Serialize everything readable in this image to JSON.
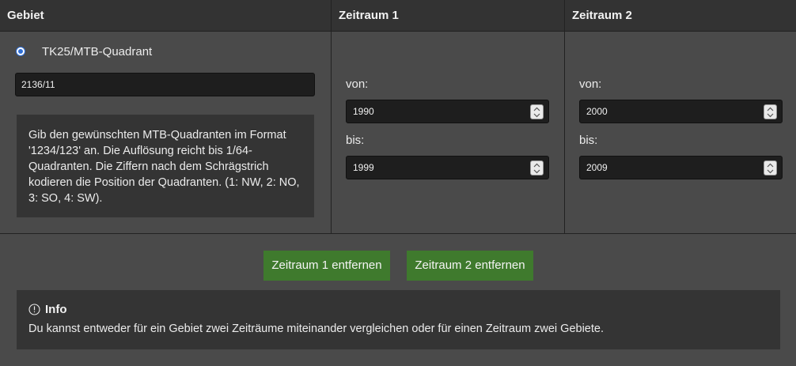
{
  "header": {
    "col1": "Gebiet",
    "col2": "Zeitraum 1",
    "col3": "Zeitraum 2"
  },
  "area": {
    "radio_label": "TK25/MTB-Quadrant",
    "radio_selected": true,
    "input_value": "2136/11",
    "hint": "Gib den gewünschten MTB-Quadranten im Format '1234/123' an. Die Auflösung reicht bis 1/64-Quadranten. Die Ziffern nach dem Schrägstrich kodieren die Position der Quadranten. (1: NW, 2: NO, 3: SO, 4: SW)."
  },
  "period1": {
    "from_label": "von:",
    "from_value": "1990",
    "to_label": "bis:",
    "to_value": "1999"
  },
  "period2": {
    "from_label": "von:",
    "from_value": "2000",
    "to_label": "bis:",
    "to_value": "2009"
  },
  "actions": {
    "remove_period1": "Zeitraum 1 entfernen",
    "remove_period2": "Zeitraum 2 entfernen"
  },
  "info": {
    "icon": "info-circle-icon",
    "title": "Info",
    "text": "Du kannst entweder für ein Gebiet zwei Zeiträume miteinander vergleichen oder für einen Zeitraum zwei Gebiete."
  },
  "colors": {
    "button": "#3f7a2d",
    "radio_accent": "#2f6fd6",
    "panel": "#343434",
    "background": "#4a4a4a"
  }
}
